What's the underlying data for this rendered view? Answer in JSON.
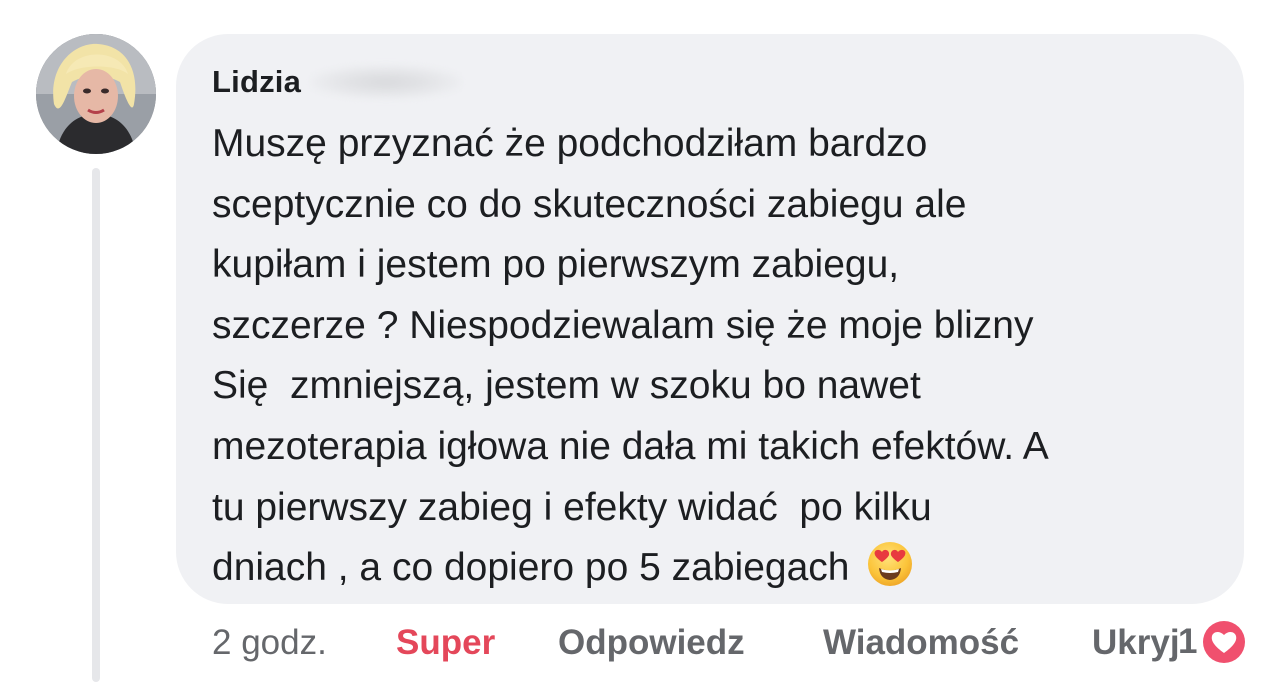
{
  "comment": {
    "author_first_name": "Lidzia",
    "text_lines": [
      "Muszę przyznać że podchodziłam bardzo",
      "sceptycznie co do skuteczności zabiegu ale",
      "kupiłam i jestem po pierwszym zabiegu,",
      "szczerze ? Niespodziewalam się że moje blizny",
      "Się  zmniejszą, jestem w szoku bo nawet",
      "mezoterapia igłowa nie dała mi takich efektów. A",
      "tu pierwszy zabieg i efekty widać  po kilku",
      "dniach , a co dopiero po 5 zabiegach"
    ],
    "emoji": "heart-eyes-emoji"
  },
  "actions": {
    "time": "2 godz.",
    "reaction_label": "Super",
    "reply_label": "Odpowiedz",
    "message_label": "Wiadomość",
    "hide_label": "Ukryj"
  },
  "reactions": {
    "count": "1",
    "icon": "heart-reaction-icon"
  },
  "colors": {
    "bubble_bg": "#f0f1f4",
    "text": "#1c1e21",
    "muted": "#65676b",
    "super_accent": "#e4475a",
    "heart_badge": "#f0506e"
  }
}
